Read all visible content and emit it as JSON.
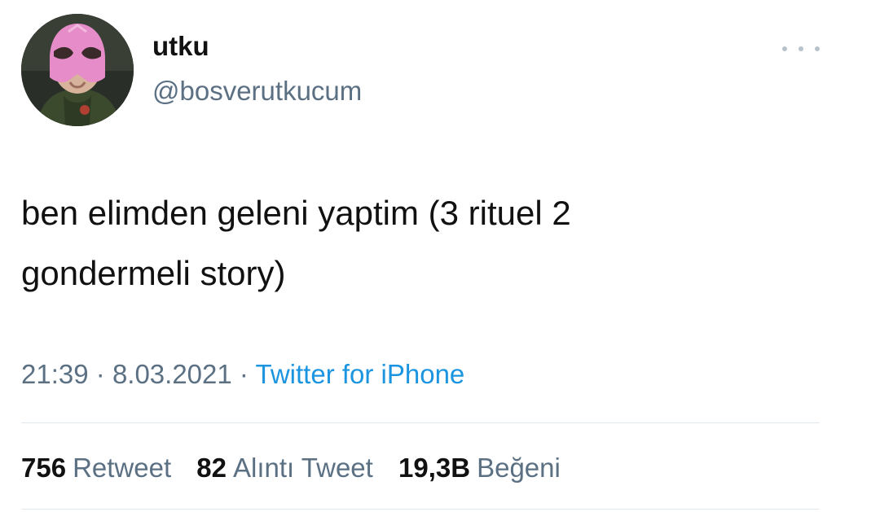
{
  "tweet": {
    "author": {
      "display_name": "utku",
      "handle": "@bosverutkucum",
      "avatar_icon": "masked-person-avatar"
    },
    "more_icon": "more-horizontal-icon",
    "text": "ben elimden geleni yaptim (3 rituel 2\ngondermeli story)",
    "time": "21:39",
    "date": "8.03.2021",
    "separator": "·",
    "source": "Twitter for iPhone",
    "stats": {
      "retweets": {
        "count": "756",
        "label": "Retweet"
      },
      "quotes": {
        "count": "82",
        "label": "Alıntı Tweet"
      },
      "likes": {
        "count": "19,3B",
        "label": "Beğeni"
      }
    }
  },
  "colors": {
    "text": "#111111",
    "secondary": "#5b7083",
    "link": "#1b95e0",
    "divider": "#e1e8ed",
    "mask": "#e68cc8"
  }
}
